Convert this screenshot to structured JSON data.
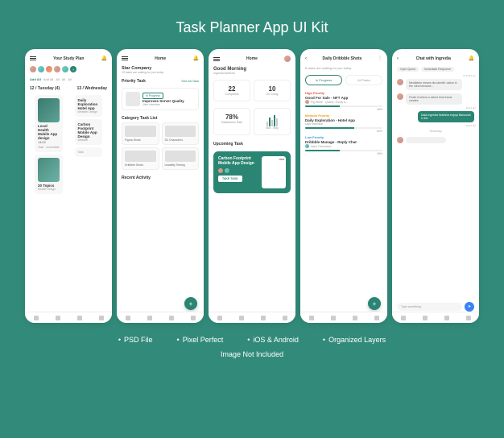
{
  "header": {
    "title": "Task Planner App UI Kit"
  },
  "screen1": {
    "title": "Your Study Plan",
    "chips": [
      "Add All",
      "Add All",
      "All",
      "All",
      "All"
    ],
    "date1": "12 / Tuesday (4)",
    "date2": "13 / Wednesday",
    "card1": {
      "title": "Local Health Mobile App design",
      "count": "14/22"
    },
    "card2": {
      "title": "Daily Exploration Hotel App",
      "sub": "Website Design"
    },
    "card3": {
      "title": "Carbon Footprint Mobile App Design",
      "sub": "Website"
    },
    "topics_label": "20 Topics",
    "sub_label": "Mobile Design",
    "tags": [
      "Task",
      "Immediate"
    ],
    "date_sub": "Task"
  },
  "screen2": {
    "title": "Home",
    "company": "Star Company",
    "company_sub": "12 tasks are waiting for you today",
    "priority_label": "Priority Task",
    "see_all": "See All Task",
    "task1": {
      "name": "Improves Server Quality",
      "meta": "User Interface",
      "badge": "In Progress"
    },
    "cat_label": "Category Task List",
    "cat1": "Figma Shots",
    "cat2": "3D Characters",
    "cat3": "Dribbble Shots",
    "cat4": "Usability Testing",
    "recent_label": "Recent Activity"
  },
  "screen3": {
    "title": "Home",
    "greeting": "Good Morning",
    "greeting_sub": "Ingredia Nutrisha",
    "stat1_num": "22",
    "stat1_lbl": "Completed",
    "stat2_num": "10",
    "stat2_lbl": "On Going",
    "stat3_num": "78%",
    "stat3_lbl": "Satisfaction Rate",
    "stat4_lbl": "Mar - May",
    "upcoming_label": "Upcoming Task",
    "featured": {
      "title": "Carbon Footprint Mobile App Design",
      "oldprice": "1509",
      "btn": "TAKE TASK"
    }
  },
  "screen4": {
    "title": "Daily Dribbble Shots",
    "subtitle": "5 tasks are waiting for you today",
    "tab1": "In Progress",
    "tab2": "All Tasks",
    "p1": {
      "label": "High Priority",
      "name": "Good For Sale - NFT App",
      "meta": "Fig White · Quartz, Sunny A...",
      "pct": "45%",
      "fill": 45
    },
    "p2": {
      "label": "Medium Priority",
      "name": "Daily Exploration - Hotel App",
      "meta": "User Interface",
      "pct": "64%",
      "fill": 64
    },
    "p3": {
      "label": "Low Priority",
      "name": "Dribbble Manage - Reply Chat",
      "meta": "Hans Oresmann",
      "pct": "45%",
      "fill": 45
    }
  },
  "screen5": {
    "title": "Chat with Ingredia",
    "tags": [
      "Open Quest",
      "Immediate Response"
    ],
    "msg1": "Meditation means dis-identifi- cation in the mind because...",
    "time1": "⊘ 10.34 am",
    "msg2": "Finish it before a select time frame creates",
    "time2": "10.11 am",
    "msg3": "Data Ingredia Nutrisha enjoys Banooshi in the",
    "time3": "10.44 am",
    "yesterday": "Yesterday",
    "input_placeholder": "Type something"
  },
  "features": [
    "PSD File",
    "Pixel Perfect",
    "iOS & Android",
    "Organized Layers"
  ],
  "footer": "Image Not Included"
}
